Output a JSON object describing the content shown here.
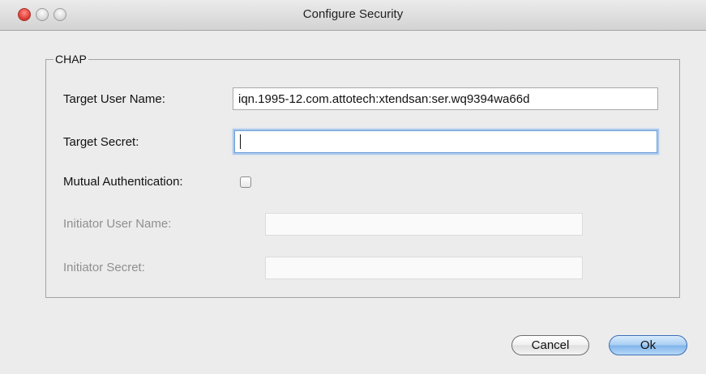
{
  "window": {
    "title": "Configure Security"
  },
  "chap": {
    "legend": "CHAP",
    "target_user_name": {
      "label": "Target User Name:",
      "value": "iqn.1995-12.com.attotech:xtendsan:ser.wq9394wa66d"
    },
    "target_secret": {
      "label": "Target Secret:",
      "value": ""
    },
    "mutual_authentication": {
      "label": "Mutual Authentication:",
      "checked": false
    },
    "initiator_user_name": {
      "label": "Initiator User Name:",
      "value": ""
    },
    "initiator_secret": {
      "label": "Initiator Secret:",
      "value": ""
    }
  },
  "buttons": {
    "cancel": "Cancel",
    "ok": "Ok"
  },
  "colors": {
    "close": "#e0413a",
    "ok_button": "#7fb4ea",
    "focus_ring": "#6f9fd8"
  }
}
